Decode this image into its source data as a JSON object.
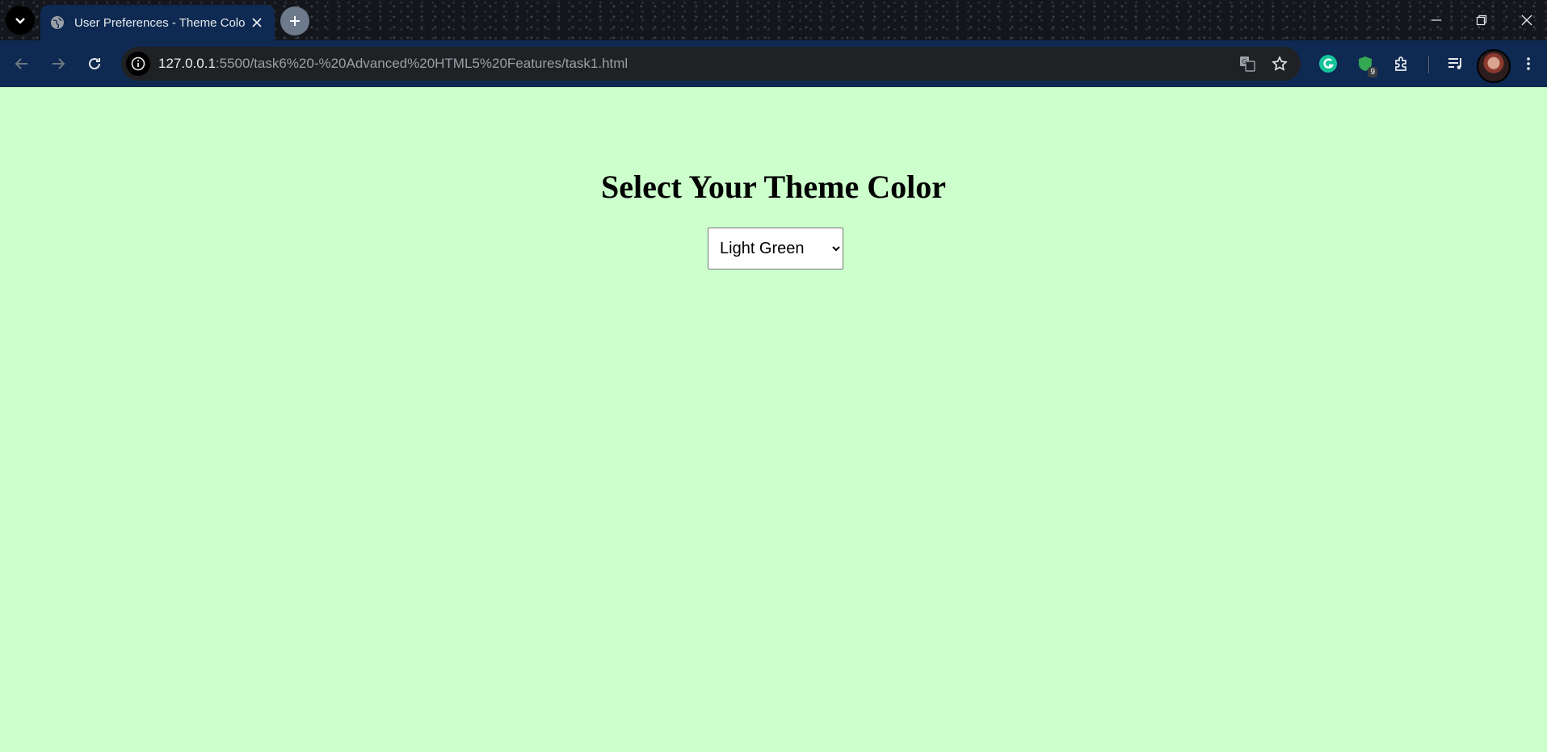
{
  "browser": {
    "tab": {
      "title": "User Preferences - Theme Color"
    },
    "address": {
      "host": "127.0.0.1",
      "path": ":5500/task6%20-%20Advanced%20HTML5%20Features/task1.html"
    },
    "extensions": {
      "badge_count": "9"
    }
  },
  "page": {
    "heading": "Select Your Theme Color",
    "theme_select": {
      "selected": "Light Green"
    },
    "background_color": "#ccffcc"
  }
}
